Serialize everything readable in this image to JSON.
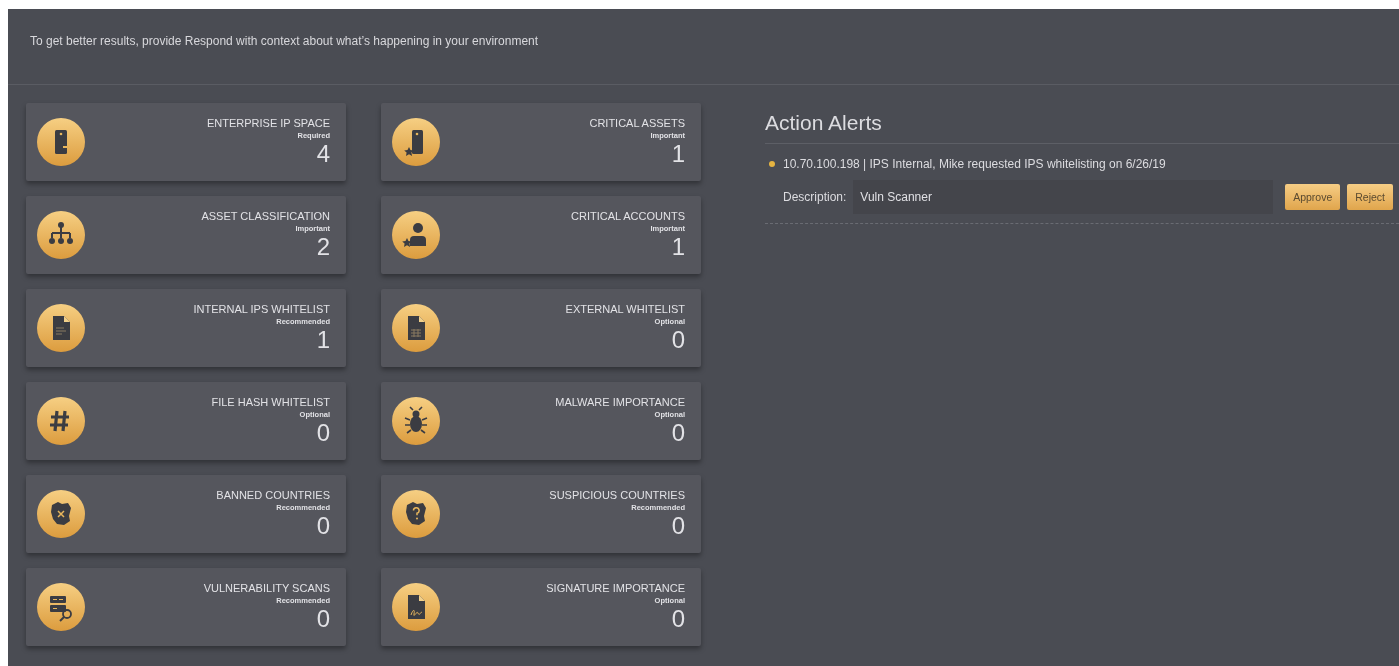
{
  "header": {
    "message": "To get better results, provide Respond with context about what’s happening in your environment"
  },
  "cards": [
    {
      "title": "ENTERPRISE IP SPACE",
      "priority": "Required",
      "count": "4",
      "kind": "server"
    },
    {
      "title": "CRITICAL ASSETS",
      "priority": "Important",
      "count": "1",
      "kind": "asset"
    },
    {
      "title": "ASSET CLASSIFICATION",
      "priority": "Important",
      "count": "2",
      "kind": "hierarchy"
    },
    {
      "title": "CRITICAL ACCOUNTS",
      "priority": "Important",
      "count": "1",
      "kind": "account"
    },
    {
      "title": "INTERNAL IPS WHITELIST",
      "priority": "Recommended",
      "count": "1",
      "kind": "document"
    },
    {
      "title": "EXTERNAL WHITELIST",
      "priority": "Optional",
      "count": "0",
      "kind": "spreadsheet"
    },
    {
      "title": "FILE HASH WHITELIST",
      "priority": "Optional",
      "count": "0",
      "kind": "hash"
    },
    {
      "title": "MALWARE IMPORTANCE",
      "priority": "Optional",
      "count": "0",
      "kind": "bug"
    },
    {
      "title": "BANNED COUNTRIES",
      "priority": "Recommended",
      "count": "0",
      "kind": "banned"
    },
    {
      "title": "SUSPICIOUS COUNTRIES",
      "priority": "Recommended",
      "count": "0",
      "kind": "suspicious"
    },
    {
      "title": "VULNERABILITY SCANS",
      "priority": "Recommended",
      "count": "0",
      "kind": "scan"
    },
    {
      "title": "SIGNATURE IMPORTANCE",
      "priority": "Optional",
      "count": "0",
      "kind": "signature"
    }
  ],
  "action_alerts": {
    "title": "Action Alerts",
    "alerts": [
      {
        "summary": "10.70.100.198 | IPS Internal, Mike requested IPS whitelisting on 6/26/19",
        "description_label": "Description:",
        "description": "Vuln Scanner",
        "buttons": [
          "Approve",
          "Reject"
        ]
      }
    ]
  }
}
